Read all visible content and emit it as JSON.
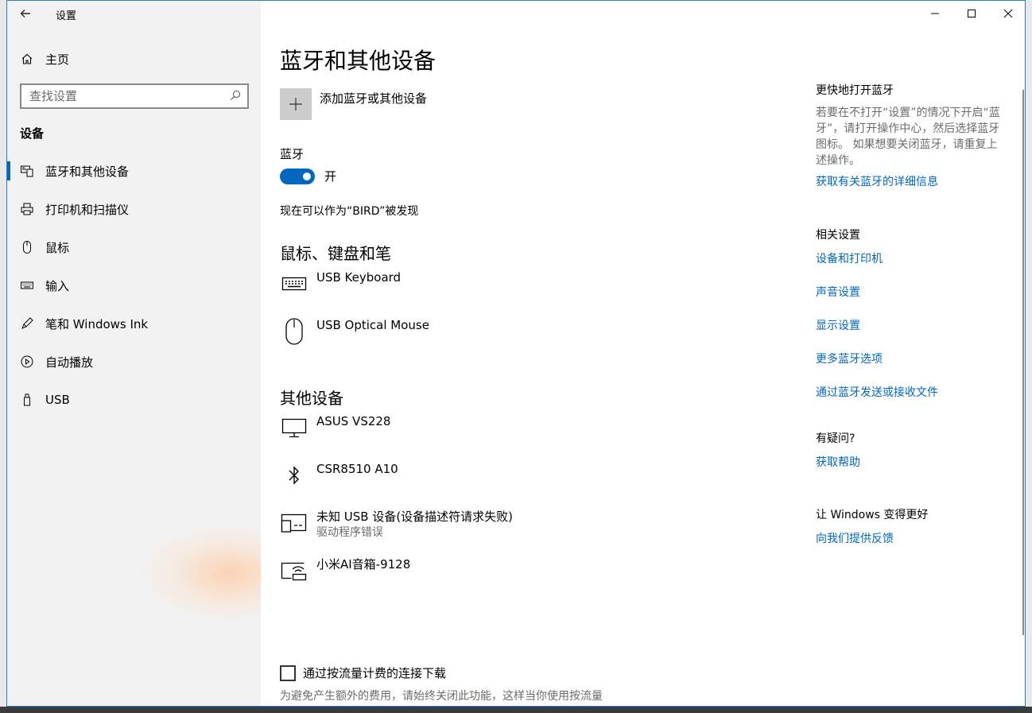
{
  "window": {
    "app_title": "设置",
    "controls": {
      "minimize": "—",
      "maximize": "☐",
      "close": "✕"
    }
  },
  "sidebar": {
    "home_label": "主页",
    "search_placeholder": "查找设置",
    "section_label": "设备",
    "items": [
      {
        "label": "蓝牙和其他设备",
        "icon": "bluetooth-devices-icon",
        "active": true
      },
      {
        "label": "打印机和扫描仪",
        "icon": "printer-icon",
        "active": false
      },
      {
        "label": "鼠标",
        "icon": "mouse-icon",
        "active": false
      },
      {
        "label": "输入",
        "icon": "keyboard-icon",
        "active": false
      },
      {
        "label": "笔和 Windows Ink",
        "icon": "pen-icon",
        "active": false
      },
      {
        "label": "自动播放",
        "icon": "autoplay-icon",
        "active": false
      },
      {
        "label": "USB",
        "icon": "usb-icon",
        "active": false
      }
    ]
  },
  "main": {
    "title": "蓝牙和其他设备",
    "add_device_label": "添加蓝牙或其他设备",
    "bluetooth_label": "蓝牙",
    "bluetooth_state": "开",
    "discoverable_text": "现在可以作为“BIRD”被发现",
    "groups": [
      {
        "title": "鼠标、键盘和笔",
        "devices": [
          {
            "name": "USB Keyboard",
            "status": "",
            "icon": "keyboard-icon"
          },
          {
            "name": "USB Optical Mouse",
            "status": "",
            "icon": "mouse-icon"
          }
        ]
      },
      {
        "title": "其他设备",
        "devices": [
          {
            "name": "ASUS VS228",
            "status": "",
            "icon": "monitor-icon"
          },
          {
            "name": "CSR8510 A10",
            "status": "",
            "icon": "bluetooth-icon"
          },
          {
            "name": "未知 USB 设备(设备描述符请求失败)",
            "status": "驱动程序错误",
            "icon": "unknown-device-icon"
          },
          {
            "name": "小米AI音箱-9128",
            "status": "",
            "icon": "speaker-device-icon"
          }
        ]
      }
    ],
    "metered_label": "通过按流量计费的连接下载",
    "metered_desc": "为避免产生额外的费用，请始终关闭此功能，这样当你使用按流量"
  },
  "right": {
    "quick_title": "更快地打开蓝牙",
    "quick_text": "若要在不打开“设置”的情况下开启“蓝牙”，请打开操作中心，然后选择蓝牙图标。 如果想要关闭蓝牙，请重复上述操作。",
    "quick_link": "获取有关蓝牙的详细信息",
    "related_title": "相关设置",
    "related_links": [
      "设备和打印机",
      "声音设置",
      "显示设置",
      "更多蓝牙选项",
      "通过蓝牙发送或接收文件"
    ],
    "question_title": "有疑问?",
    "help_link": "获取帮助",
    "improve_title": "让 Windows 变得更好",
    "feedback_link": "向我们提供反馈"
  },
  "colors": {
    "accent": "#0067c0",
    "sidebar_bg": "#f2f2f2",
    "secondary_text": "#6b6b6b"
  }
}
